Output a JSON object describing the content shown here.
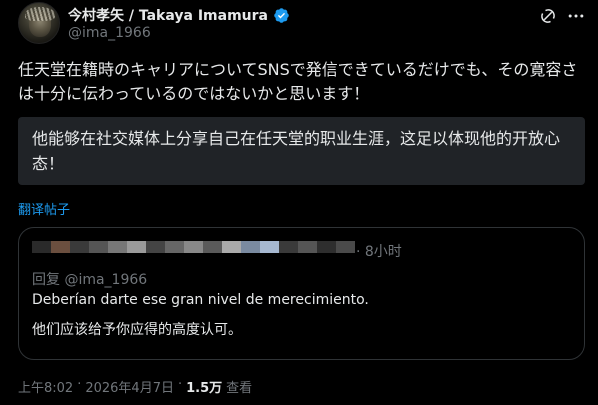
{
  "author": {
    "display_name": "今村孝矢 / Takaya Imamura",
    "handle": "@ima_1966",
    "verified": true
  },
  "tweet": {
    "text": "任天堂在籍時のキャリアについてSNSで発信できているだけでも、その寛容さは十分に伝わっているのではないかと思います！"
  },
  "translation": {
    "text": "他能够在社交媒体上分享自己在任天堂的职业生涯，这足以体现他的开放心态！"
  },
  "translate_link": "翻译帖子",
  "quote": {
    "time": "· 8小时",
    "reply_to": "回复 @ima_1966",
    "text": "Deberían darte ese gran nivel de merecimiento.",
    "translated_text": "他们应该给予你应得的高度认可。",
    "pixel_colors": [
      "#2a2a2a",
      "#6b4f3f",
      "#3a3a3a",
      "#555555",
      "#777777",
      "#9a9a9a",
      "#444444",
      "#666666",
      "#888888",
      "#5a5a5a",
      "#aaaaaa",
      "#7a8aa0",
      "#a6b8d0",
      "#3a3a3a",
      "#555555",
      "#2e2e2e",
      "#4a4a4a"
    ]
  },
  "meta": {
    "time": "上午8:02",
    "sep1": "·",
    "date": "2026年4月7日",
    "sep2": "·",
    "views": "1.5万",
    "views_label": "查看"
  },
  "colors": {
    "accent": "#1d9bf0",
    "background": "#000000",
    "muted": "#71767b",
    "translation_bg": "#202327"
  },
  "icons": [
    "verified-badge-icon",
    "grok-icon",
    "more-icon"
  ]
}
